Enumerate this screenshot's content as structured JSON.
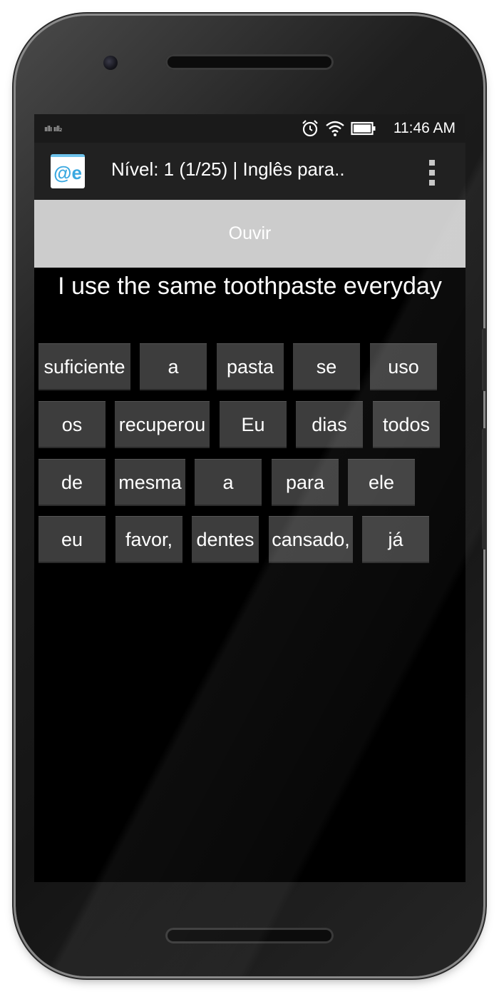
{
  "statusbar": {
    "signal": "ııllı ııll₂",
    "time": "11:46 AM",
    "icons": [
      "alarm-icon",
      "wifi-icon",
      "battery-icon"
    ]
  },
  "actionbar": {
    "app_icon_text": "@e",
    "title": "Nível: 1 (1/25) | Inglês para..",
    "menu_icon": "overflow-menu-icon"
  },
  "listen_button": "Ouvir",
  "sentence": "I use the same toothpaste everyday",
  "words": [
    [
      "suficiente",
      "a",
      "pasta",
      "se",
      "uso"
    ],
    [
      "os",
      "recuperou",
      "Eu",
      "dias",
      "todos"
    ],
    [
      "de",
      "mesma",
      "a",
      "para",
      "ele"
    ],
    [
      "eu",
      "favor,",
      "dentes",
      "cansado,",
      "já"
    ]
  ],
  "colors": {
    "screen_bg": "#000000",
    "actionbar_bg": "#212121",
    "listen_button_bg": "#cccccc",
    "word_button_bg": "#3d3d3d",
    "app_icon_accent": "#3aa8e0"
  }
}
